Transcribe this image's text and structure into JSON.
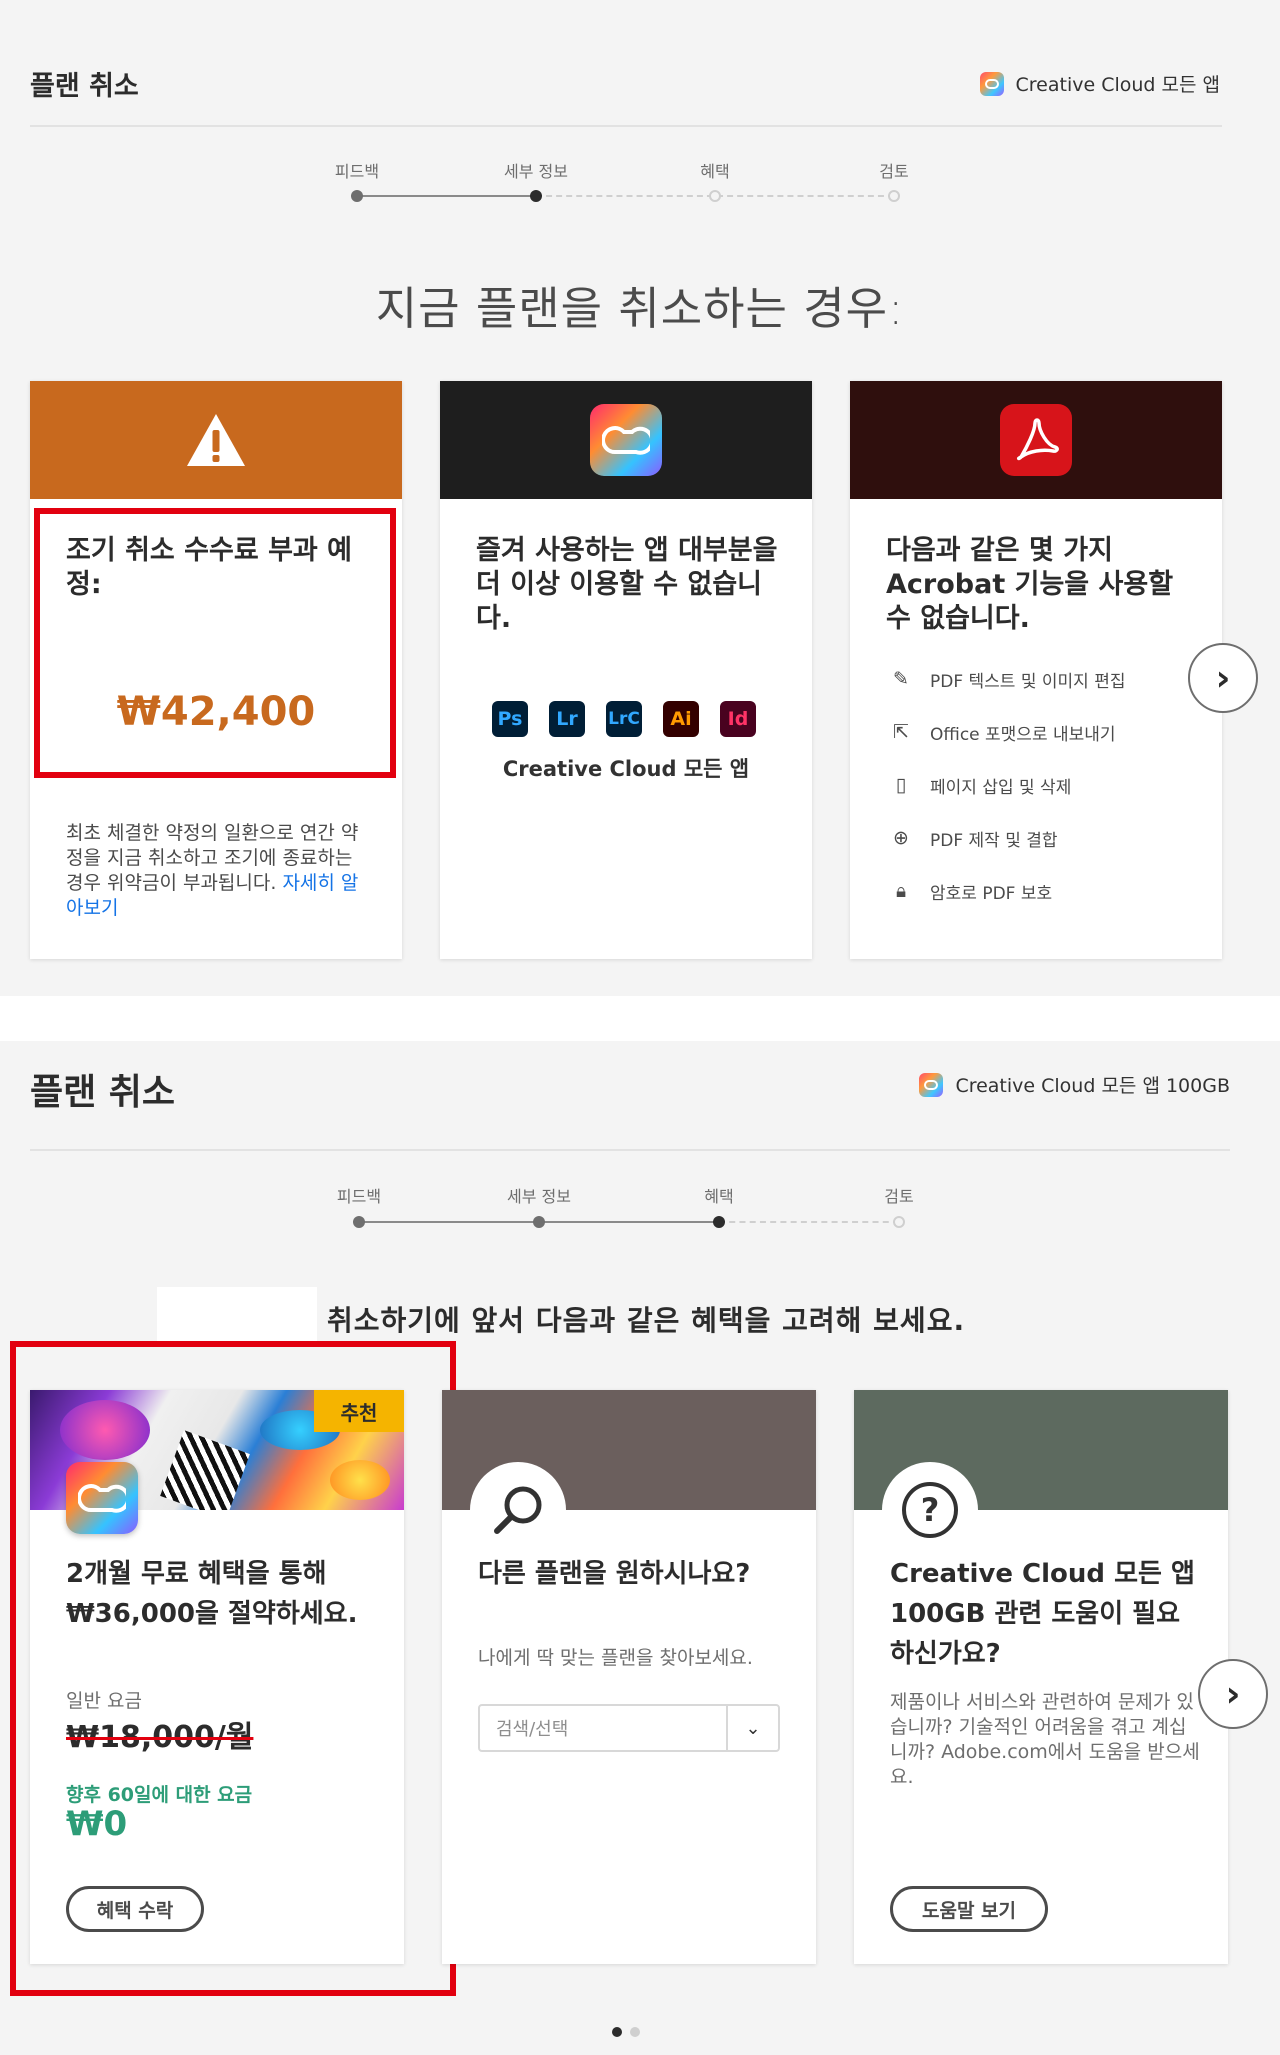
{
  "panel1": {
    "title": "플랜 취소",
    "product": "Creative Cloud 모든 앱",
    "steps": [
      "피드백",
      "세부 정보",
      "혜택",
      "검토"
    ],
    "headline": "지금 플랜을 취소하는 경우:",
    "cards": {
      "fee": {
        "title": "조기 취소 수수료 부과 예정:",
        "price": "₩42,400",
        "desc": "최초 체결한 약정의 일환으로 연간 약정을 지금 취소하고 조기에 종료하는 경우 위약금이 부과됩니다.",
        "link": "자세히 알아보기",
        "icon": "warning-icon",
        "color": "#c8691e"
      },
      "apps": {
        "title": "즐겨 사용하는 앱 대부분을 더 이상 이용할 수 없습니다.",
        "app_tiles": [
          "Ps",
          "Lr",
          "LrC",
          "Ai",
          "Id"
        ],
        "caption": "Creative Cloud 모든 앱",
        "icon": "creative-cloud-icon"
      },
      "acrobat": {
        "title": "다음과 같은 몇 가지 Acrobat 기능을 사용할 수 없습니다.",
        "features": [
          {
            "icon": "pencil-icon",
            "label": "PDF 텍스트 및 이미지 편집"
          },
          {
            "icon": "export-icon",
            "label": "Office 포맷으로 내보내기"
          },
          {
            "icon": "page-icon",
            "label": "페이지 삽입 및 삭제"
          },
          {
            "icon": "plus-circle-icon",
            "label": "PDF 제작 및 결합"
          },
          {
            "icon": "lock-icon",
            "label": "암호로 PDF 보호"
          }
        ],
        "icon": "acrobat-icon"
      }
    }
  },
  "panel2": {
    "title": "플랜 취소",
    "product": "Creative Cloud 모든 앱 100GB",
    "steps": [
      "피드백",
      "세부 정보",
      "혜택",
      "검토"
    ],
    "headline": "취소하기에 앞서 다음과 같은 혜택을 고려해 보세요.",
    "cards": {
      "offer": {
        "badge": "추천",
        "title": "2개월 무료 혜택을 통해 ₩36,000을 절약하세요.",
        "regular_label": "일반 요금",
        "regular_price": "₩18,000/월",
        "next_label": "향후 60일에 대한 요금",
        "next_price": "₩0",
        "button": "혜택 수락"
      },
      "plan": {
        "title": "다른 플랜을 원하시나요?",
        "desc": "나에게 딱 맞는 플랜을 찾아보세요.",
        "select_placeholder": "검색/선택",
        "icon": "search-icon"
      },
      "help": {
        "title": "Creative Cloud 모든 앱 100GB 관련 도움이 필요하신가요?",
        "desc": "제품이나 서비스와 관련하여 문제가 있습니까? 기술적인 어려움을 겪고 계십니까? Adobe.com에서 도움을 받으세요.",
        "button": "도움말 보기",
        "icon": "question-icon"
      }
    }
  },
  "colors": {
    "highlight": "#e2000f",
    "orange": "#c8691e",
    "green": "#2d9d78",
    "link": "#1473e6"
  }
}
